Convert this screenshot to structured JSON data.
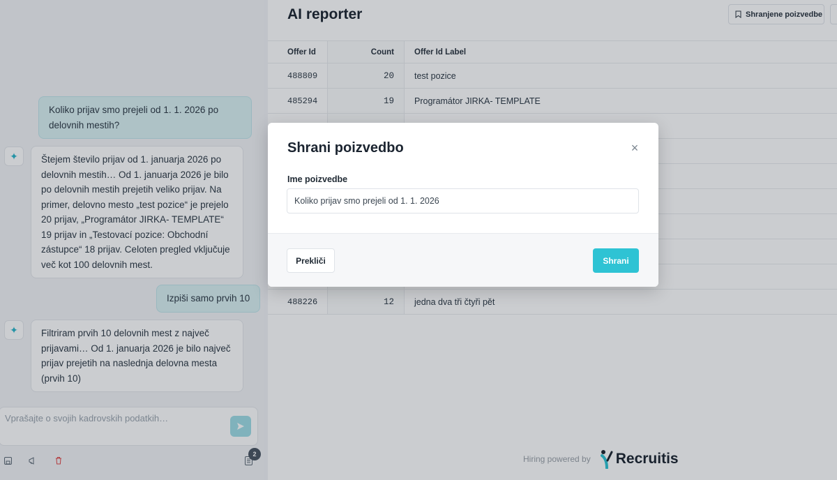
{
  "colors": {
    "accent": "#2ec3d4",
    "user_bubble": "#daf1f3",
    "delete_red": "#e04545",
    "overlay": "rgba(17,27,39,0.22)"
  },
  "chat": {
    "messages": [
      {
        "role": "user",
        "text": "Koliko prijav smo prejeli od 1. 1. 2026 po delovnih mestih?"
      },
      {
        "role": "assistant",
        "icon": "sparkle-icon",
        "text": "Štejem število prijav od 1. januarja 2026 po delovnih mestih… Od 1. januarja 2026 je bilo po delovnih mestih prejetih veliko prijav. Na primer, delovno mesto „test pozice“ je prejelo 20 prijav, „Programátor JIRKA- TEMPLATE“ 19 prijav in „Testovací pozice: Obchodní zástupce“ 18 prijav. Celoten pregled vključuje več kot 100 delovnih mest."
      },
      {
        "role": "user",
        "text": "Izpiši samo prvih 10"
      },
      {
        "role": "assistant",
        "icon": "sparkle-icon",
        "text": "Filtriram prvih 10 delovnih mest z največ prijavami… Od 1. januarja 2026 je bilo največ prijav prejetih na naslednja delovna mesta (prvih 10)"
      }
    ],
    "input": {
      "placeholder": "Vprašajte o svojih kadrovskih podatkih…",
      "value": ""
    },
    "toolbar": {
      "save_icon": "save-icon",
      "share_icon": "megaphone-icon",
      "delete_icon": "trash-icon",
      "history_icon": "document-icon",
      "history_count": "2"
    }
  },
  "report": {
    "title": "AI reporter",
    "saved_queries_label": "Shranjene poizvedbe",
    "columns": [
      "Offer Id",
      "Count",
      "Offer Id Label"
    ],
    "rows": [
      {
        "offer_id": "488809",
        "count": "20",
        "label": "test pozice"
      },
      {
        "offer_id": "485294",
        "count": "19",
        "label": "Programátor JIRKA- TEMPLATE"
      },
      {
        "offer_id": "",
        "count": "",
        "label": ""
      },
      {
        "offer_id": "",
        "count": "",
        "label": ""
      },
      {
        "offer_id": "",
        "count": "",
        "label": ""
      },
      {
        "offer_id": "",
        "count": "",
        "label": ""
      },
      {
        "offer_id": "",
        "count": "",
        "label": ""
      },
      {
        "offer_id": "",
        "count": "",
        "label": ""
      },
      {
        "offer_id": "",
        "count": "",
        "label": ""
      },
      {
        "offer_id": "488226",
        "count": "12",
        "label": "jedna dva tři čtyři pět"
      }
    ],
    "footer": {
      "powered_by": "Hiring powered by",
      "brand": "Recruitis"
    }
  },
  "modal": {
    "title": "Shrani poizvedbo",
    "field_label": "Ime poizvedbe",
    "field_value": "Koliko prijav smo prejeli od 1. 1. 2026",
    "cancel_label": "Prekliči",
    "save_label": "Shrani"
  }
}
